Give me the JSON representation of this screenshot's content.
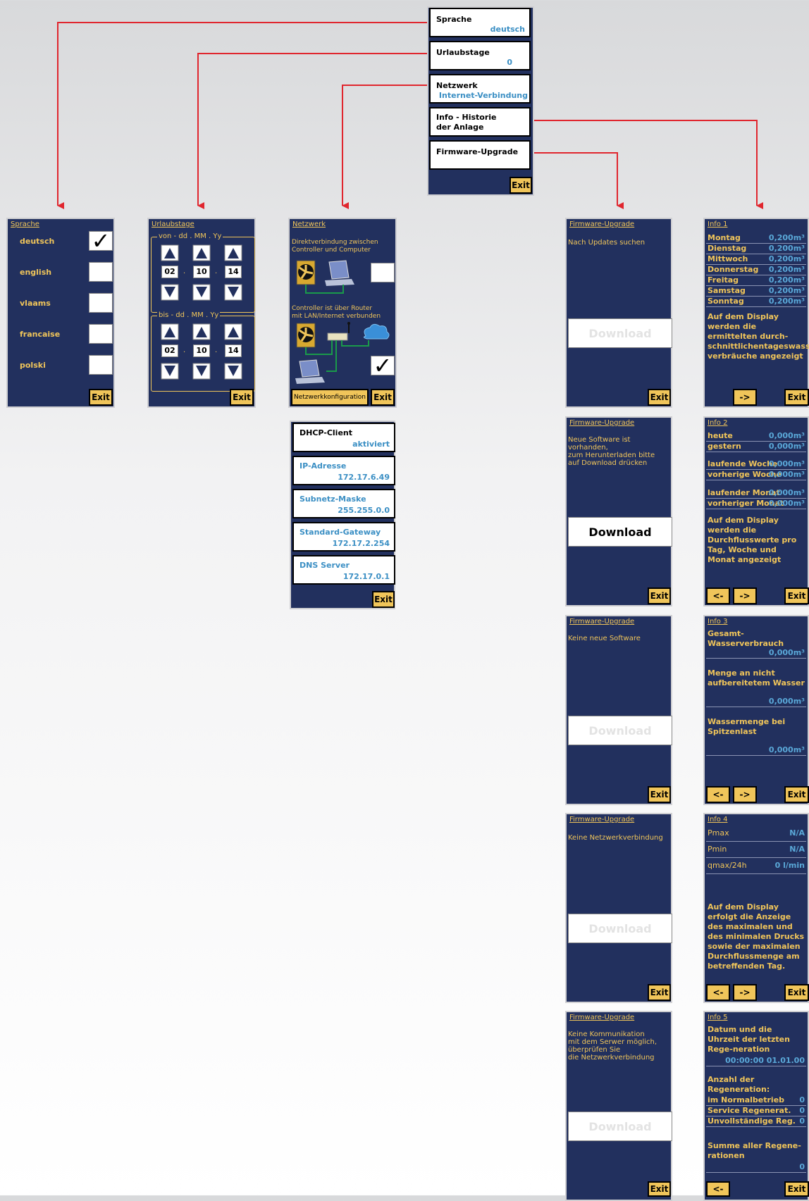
{
  "menu": {
    "items": [
      {
        "label": "Sprache",
        "value": "deutsch"
      },
      {
        "label": "Urlaubstage",
        "value": "0"
      },
      {
        "label": "Netzwerk",
        "value": "Internet-Verbindung"
      },
      {
        "label": "Info - Historie\nder Anlage",
        "value": ""
      },
      {
        "label": "Firmware-Upgrade",
        "value": ""
      }
    ],
    "exit": "Exit"
  },
  "sprache": {
    "title": "Sprache",
    "options": [
      {
        "label": "deutsch",
        "checked": true
      },
      {
        "label": "english",
        "checked": false
      },
      {
        "label": "vlaams",
        "checked": false
      },
      {
        "label": "francaise",
        "checked": false
      },
      {
        "label": "polski",
        "checked": false
      }
    ],
    "exit": "Exit"
  },
  "urlaub": {
    "title": "Urlaubstage",
    "from_label": "von - dd . MM . Yy",
    "to_label": "bis - dd . MM . Yy",
    "from": {
      "dd": "02",
      "mm": "10",
      "yy": "14"
    },
    "to": {
      "dd": "02",
      "mm": "10",
      "yy": "14"
    },
    "exit": "Exit"
  },
  "netzwerk": {
    "title": "Netzwerk",
    "text1": "Direktverbindung zwischen\nController und Computer",
    "text2": "Controller ist über Router\nmit LAN/Internet verbunden",
    "config_button": "Netzwerkkonfiguration",
    "exit": "Exit",
    "direct_checked": false,
    "router_checked": true
  },
  "netconfig": {
    "fields": [
      {
        "label": "DHCP-Client",
        "value": "aktiviert"
      },
      {
        "label": "IP-Adresse",
        "value": "172.17.6.49"
      },
      {
        "label": "Subnetz-Maske",
        "value": "255.255.0.0"
      },
      {
        "label": "Standard-Gateway",
        "value": "172.17.2.254"
      },
      {
        "label": "DNS Server",
        "value": "172.17.0.1"
      }
    ],
    "exit": "Exit"
  },
  "firmware": {
    "title": "Firmware-Upgrade",
    "download": "Download",
    "exit": "Exit",
    "screens": [
      {
        "text": "Nach Updates suchen",
        "active": false
      },
      {
        "text": "Neue Software ist vorhanden,\nzum Herunterladen bitte\nauf Download drücken",
        "active": true
      },
      {
        "text": "Keine neue Software",
        "active": false
      },
      {
        "text": "Keine Netzwerkverbindung",
        "active": false
      },
      {
        "text": "Keine Kommunikation\nmit dem Serwer möglich,\nüberprüfen Sie\ndie Netzwerkverbindung",
        "active": false
      }
    ]
  },
  "info1": {
    "title": "Info 1",
    "rows": [
      {
        "k": "Montag",
        "v": "0,200m³"
      },
      {
        "k": "Dienstag",
        "v": "0,200m³"
      },
      {
        "k": "Mittwoch",
        "v": "0,200m³"
      },
      {
        "k": "Donnerstag",
        "v": "0,200m³"
      },
      {
        "k": "Freitag",
        "v": "0,200m³"
      },
      {
        "k": "Samstag",
        "v": "0,200m³"
      },
      {
        "k": "Sonntag",
        "v": "0,200m³"
      }
    ],
    "text": "Auf dem Display werden die ermittelten durch-schnittlichentageswasser-verbräuche angezeigt",
    "next": "->",
    "exit": "Exit"
  },
  "info2": {
    "title": "Info 2",
    "rows": [
      {
        "k": "heute",
        "v": "0,000m³"
      },
      {
        "k": "gestern",
        "v": "0,000m³"
      },
      {
        "k": "laufende Woche",
        "v": "0,000m³"
      },
      {
        "k": "vorherige Woche",
        "v": "0,000m³"
      },
      {
        "k": "laufender Monat",
        "v": "0,000m³"
      },
      {
        "k": "vorheriger Monat",
        "v": "0,000m³"
      }
    ],
    "text": "Auf dem Display werden die Durchflusswerte pro Tag, Woche und Monat angezeigt",
    "prev": "<-",
    "next": "->",
    "exit": "Exit"
  },
  "info3": {
    "title": "Info 3",
    "label1": "Gesamt-Wasserverbrauch",
    "value1": "0,000m³",
    "label2": "Menge an nicht aufbereitetem Wasser",
    "value2": "0,000m³",
    "label3": "Wassermenge bei Spitzenlast",
    "value3": "0,000m³",
    "prev": "<-",
    "next": "->",
    "exit": "Exit"
  },
  "info4": {
    "title": "Info 4",
    "rows": [
      {
        "k": "Pmax",
        "v": "N/A"
      },
      {
        "k": "Pmin",
        "v": "N/A"
      },
      {
        "k": "qmax/24h",
        "v": "0 l/min"
      }
    ],
    "text": "Auf dem Display erfolgt die Anzeige des maximalen und des minimalen Drucks sowie der maximalen Durchflussmenge am betreffenden Tag.",
    "prev": "<-",
    "next": "->",
    "exit": "Exit"
  },
  "info5": {
    "title": "Info 5",
    "text1": "Datum und die Uhrzeit der letzten Rege-neration",
    "datetime": "00:00:00 01.01.00",
    "text2": "Anzahl der Regeneration:",
    "rows": [
      {
        "k": "im Normalbetrieb",
        "v": "0"
      },
      {
        "k": "Service Regenerat.",
        "v": "0"
      },
      {
        "k": "Unvollständige Reg.",
        "v": "0"
      }
    ],
    "text3": "Summe aller Regene-rationen",
    "sum": "0",
    "prev": "<-",
    "exit": "Exit"
  },
  "colors": {
    "panel": "#22305e",
    "accent": "#f0c55a",
    "value": "#5aa8d8",
    "connector": "#e0262e"
  }
}
